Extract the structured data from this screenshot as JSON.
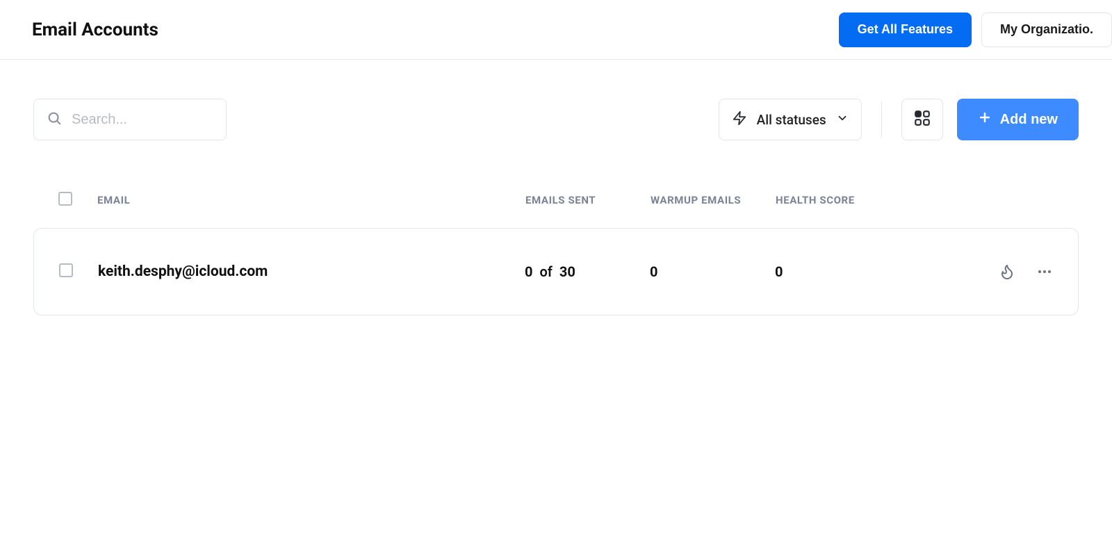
{
  "header": {
    "title": "Email Accounts",
    "get_features_label": "Get All Features",
    "org_label": "My Organizatio."
  },
  "toolbar": {
    "search_placeholder": "Search...",
    "status_filter_label": "All statuses",
    "add_new_label": "Add new"
  },
  "columns": {
    "email": "EMAIL",
    "emails_sent": "EMAILS SENT",
    "warmup_emails": "WARMUP EMAILS",
    "health_score": "HEALTH SCORE"
  },
  "rows": [
    {
      "email": "keith.desphy@icloud.com",
      "emails_sent_current": "0",
      "emails_sent_of_word": "of",
      "emails_sent_limit": "30",
      "warmup_emails": "0",
      "health_score": "0"
    }
  ]
}
